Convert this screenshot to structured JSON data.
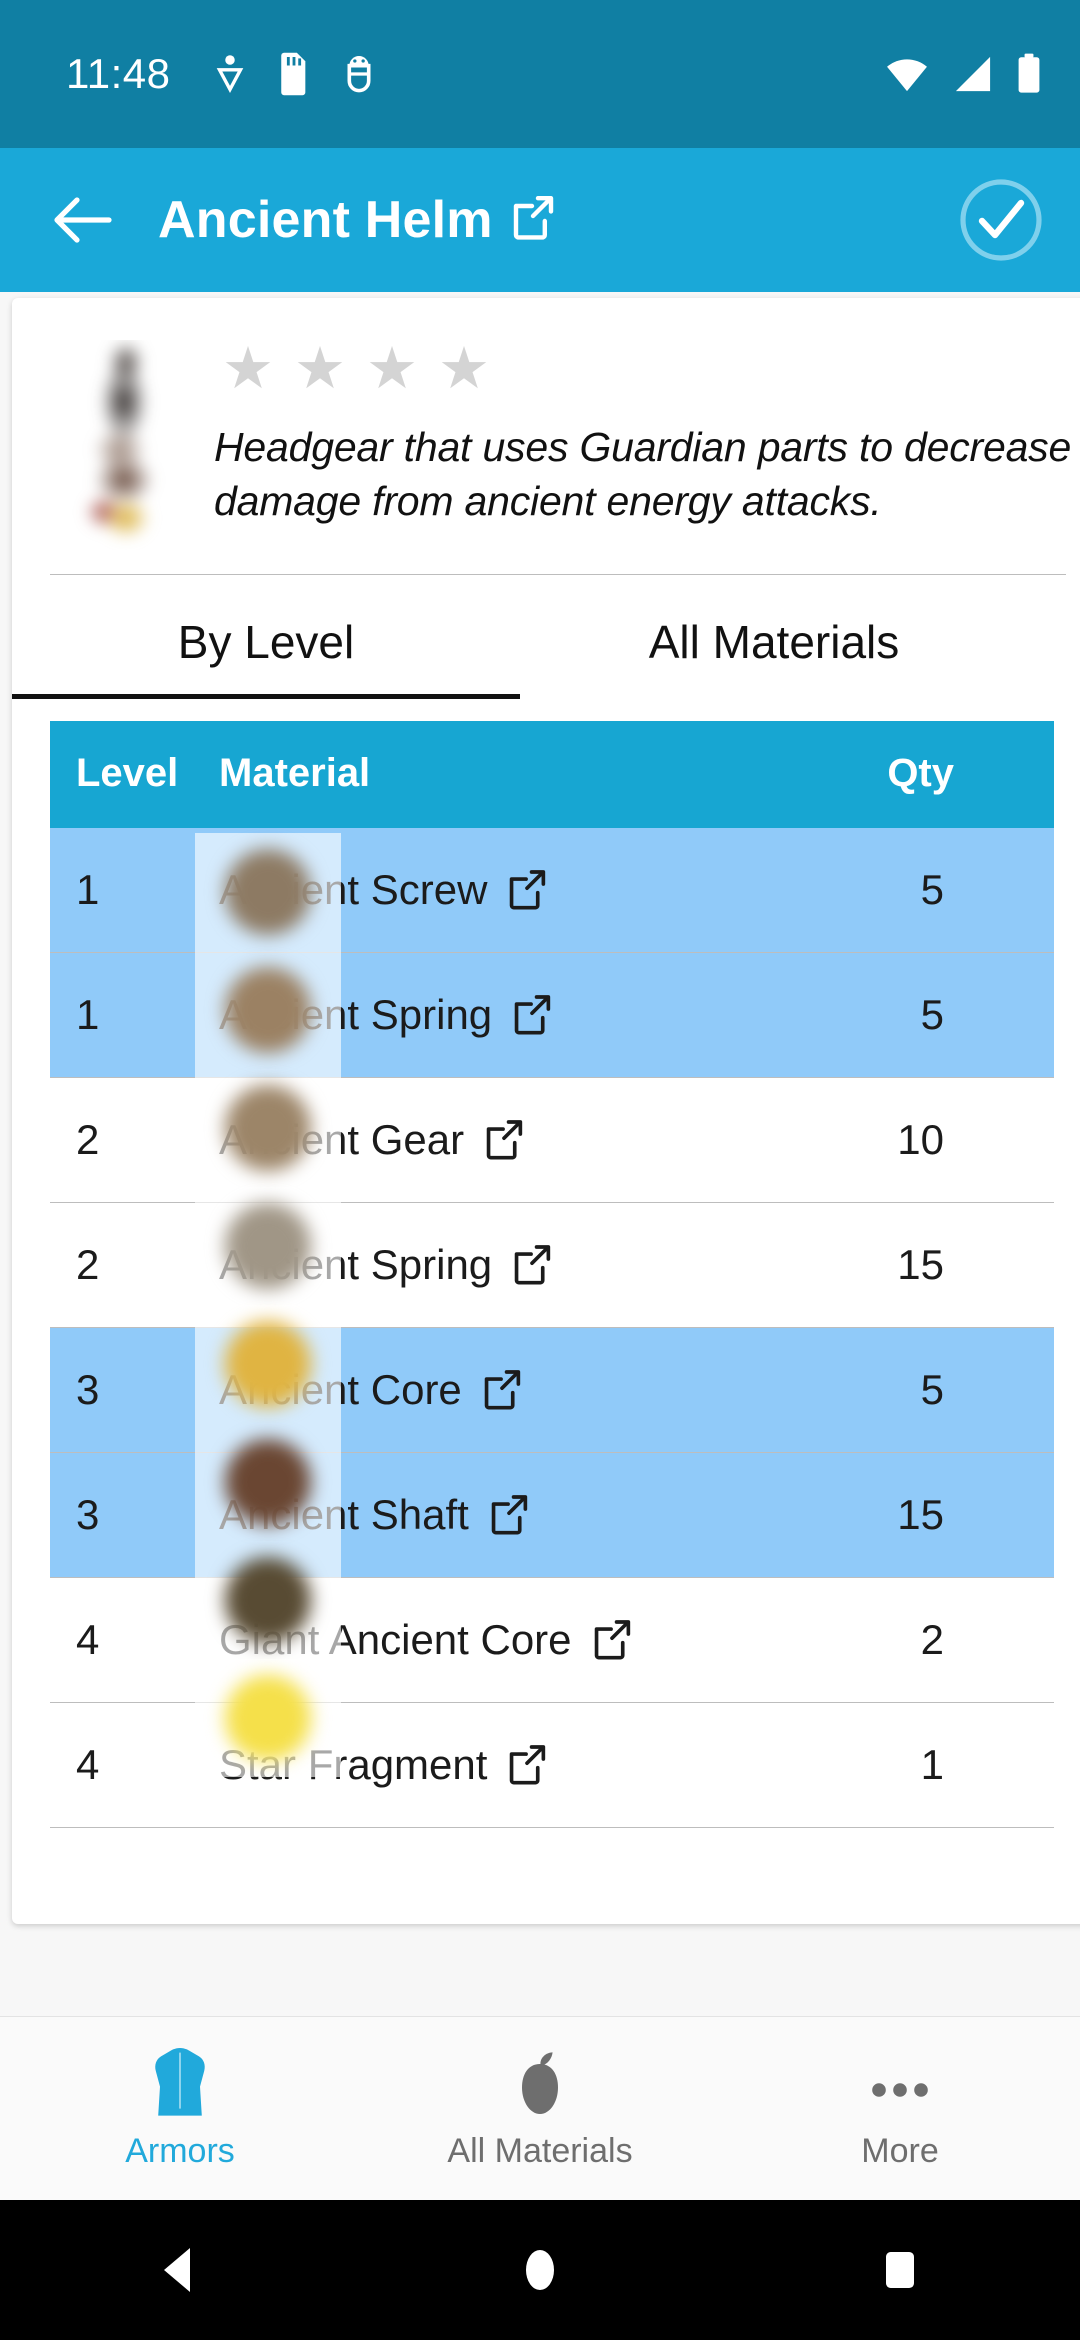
{
  "status_bar": {
    "time": "11:48",
    "left_icons": [
      "heart-pulse-icon",
      "sd-card-icon",
      "android-debug-icon"
    ],
    "right_icons": [
      "wifi-icon",
      "cellular-signal-icon",
      "battery-full-icon"
    ],
    "background": "#107FA3"
  },
  "app_bar": {
    "back_label": "Back",
    "title": "Ancient Helm",
    "title_link_icon": "external-link-icon",
    "action_icon": "check-circle-icon",
    "background": "#1AA8D8"
  },
  "item": {
    "thumbnail_alt": "Ancient Helm",
    "stars_total": 4,
    "stars_filled": 0,
    "star_color": "#d4d4d4",
    "description": "Headgear that uses Guardian parts to decrease the damage from ancient energy attacks."
  },
  "tabs": [
    {
      "label": "By Level",
      "active": true
    },
    {
      "label": "All Materials",
      "active": false
    }
  ],
  "table": {
    "header_background": "#17A6D2",
    "highlight_background": "#90CAF9",
    "columns": [
      "Level",
      "Material",
      "Qty"
    ],
    "rows": [
      {
        "level": "1",
        "material": "Ancient Screw",
        "qty": "5",
        "highlighted": true,
        "link_icon": "external-link-icon",
        "thumb": "ancient-screw-thumb",
        "thumb_color": "#8d7a63"
      },
      {
        "level": "1",
        "material": "Ancient Spring",
        "qty": "5",
        "highlighted": true,
        "link_icon": "external-link-icon",
        "thumb": "ancient-spring-thumb",
        "thumb_color": "#9b8163"
      },
      {
        "level": "2",
        "material": "Ancient Gear",
        "qty": "10",
        "highlighted": false,
        "link_icon": "external-link-icon",
        "thumb": "ancient-gear-thumb",
        "thumb_color": "#9c8568"
      },
      {
        "level": "2",
        "material": "Ancient Spring",
        "qty": "15",
        "highlighted": false,
        "link_icon": "external-link-icon",
        "thumb": "ancient-spring-thumb",
        "thumb_color": "#a09686"
      },
      {
        "level": "3",
        "material": "Ancient Core",
        "qty": "5",
        "highlighted": true,
        "link_icon": "external-link-icon",
        "thumb": "ancient-core-thumb",
        "thumb_color": "#e0b442"
      },
      {
        "level": "3",
        "material": "Ancient Shaft",
        "qty": "15",
        "highlighted": true,
        "link_icon": "external-link-icon",
        "thumb": "ancient-shaft-thumb",
        "thumb_color": "#6a4632"
      },
      {
        "level": "4",
        "material": "Giant Ancient Core",
        "qty": "2",
        "highlighted": false,
        "link_icon": "external-link-icon",
        "thumb": "giant-ancient-core-thumb",
        "thumb_color": "#584b33"
      },
      {
        "level": "4",
        "material": "Star Fragment",
        "qty": "1",
        "highlighted": false,
        "link_icon": "external-link-icon",
        "thumb": "star-fragment-thumb",
        "thumb_color": "#f5e04a"
      }
    ]
  },
  "bottom_nav": {
    "active_color": "#21A9DB",
    "inactive_color": "#6e6e6e",
    "items": [
      {
        "label": "Armors",
        "icon": "armor-tunic-icon",
        "active": true
      },
      {
        "label": "All Materials",
        "icon": "material-seed-icon",
        "active": false
      },
      {
        "label": "More",
        "icon": "more-dots-icon",
        "active": false
      }
    ]
  },
  "android_nav": {
    "back": "back-triangle-icon",
    "home": "home-circle-icon",
    "recents": "recents-square-icon"
  }
}
